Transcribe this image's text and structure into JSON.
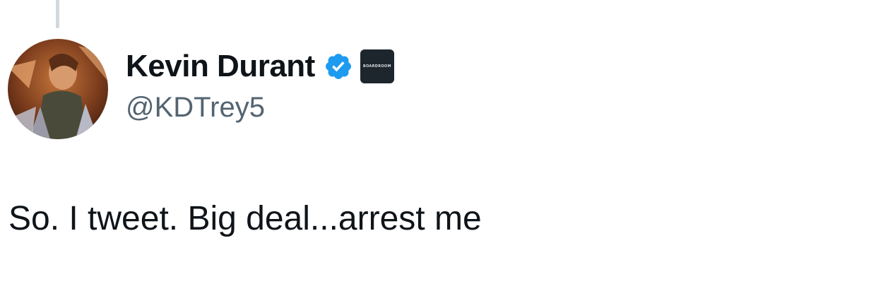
{
  "tweet": {
    "author": {
      "display_name": "Kevin Durant",
      "handle": "@KDTrey5",
      "verified": true,
      "verified_badge_icon": "verified-badge-icon",
      "affiliate_badge_text": "BOARDROOM",
      "affiliate_badge_icon": "boardroom-logo-icon",
      "avatar_icon": "profile-avatar"
    },
    "text": "So. I tweet. Big deal...arrest me"
  },
  "colors": {
    "text_primary": "#0f1419",
    "text_secondary": "#536471",
    "verified_blue": "#1d9bf0",
    "thread_line": "#cfd9de",
    "affiliate_badge_bg": "#1d262d"
  }
}
